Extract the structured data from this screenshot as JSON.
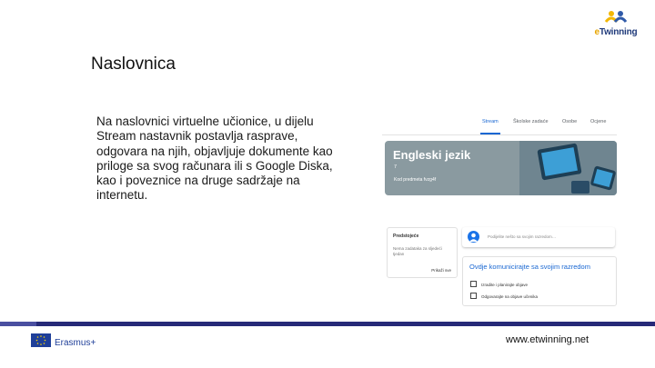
{
  "logo": {
    "text_prefix": "e",
    "text_main": "Twinning"
  },
  "page_title": "Naslovnica",
  "body_text": "Na naslovnici virtuelne učionice, u dijelu Stream nastavnik postavlja rasprave, odgovara na njih, objavljuje dokumente kao priloge sa svog računara ili s Google Diska, kao i poveznice na druge sadržaje na internetu.",
  "classroom": {
    "tabs": [
      "Stream",
      "Školske zadaće",
      "Osobe",
      "Ocjene"
    ],
    "active_tab": "Stream",
    "banner": {
      "title": "Engleski jezik",
      "subtitle": "7",
      "class_code_label": "Kod predmeta  fvzg4f"
    },
    "upcoming": {
      "title": "Predstojeće",
      "text": "Nema zadataka za sljedeći tjedan",
      "link": "Prikaži sve"
    },
    "share_placeholder": "Podijelite nešto sa svojim razredom…",
    "communicate": {
      "title": "Ovdje komunicirajte sa svojim razredom",
      "items": [
        "Izradite i planirajte objave",
        "Odgovarajte na objave učenika"
      ]
    }
  },
  "footer": {
    "erasmus": "Erasmus+",
    "website": "www.etwinning.net"
  },
  "colors": {
    "accent_blue": "#1967d2",
    "footer_band": "#262a78",
    "banner": "#8a9aa0"
  }
}
